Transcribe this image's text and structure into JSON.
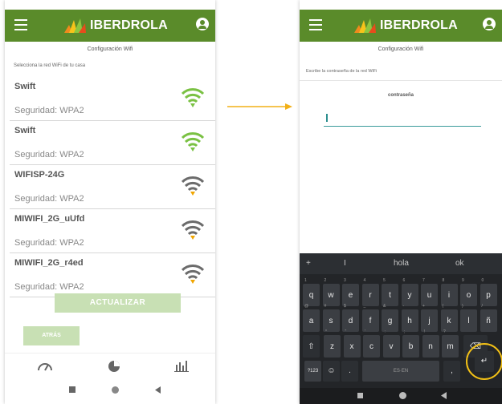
{
  "app": {
    "brand": "IBERDROLA"
  },
  "screen1": {
    "title": "Configuración Wifi",
    "subtitle": "Selecciona la red WiFi de tu casa",
    "networks": [
      {
        "name": "Swift",
        "security": "Seguridad: WPA2",
        "signal_color": "#7ac143"
      },
      {
        "name": "Swift",
        "security": "Seguridad: WPA2",
        "signal_color": "#7ac143"
      },
      {
        "name": "WIFISP-24G",
        "security": "Seguridad: WPA2",
        "signal_color": "#6b6b6b"
      },
      {
        "name": "MIWIFI_2G_uUfd",
        "security": "Seguridad: WPA2",
        "signal_color": "#6b6b6b"
      },
      {
        "name": "MIWIFI_2G_r4ed",
        "security": "Seguridad: WPA2",
        "signal_color": "#6b6b6b"
      }
    ],
    "update_button": "ACTUALIZAR",
    "back_button": "ATRÁS",
    "bottom_nav": [
      "speedometer-icon",
      "pie-chart-icon",
      "bar-chart-icon"
    ]
  },
  "screen2": {
    "title": "Configuración Wifi",
    "subtitle": "Escribe la contraseña de la red WiFi",
    "field_label": "contraseña",
    "password_value": ""
  },
  "keyboard": {
    "suggestions": [
      "+",
      "I",
      "hola",
      "ok"
    ],
    "row1": [
      "q",
      "w",
      "e",
      "r",
      "t",
      "y",
      "u",
      "i",
      "o",
      "p"
    ],
    "row1_alt": [
      "1",
      "2",
      "3",
      "4",
      "5",
      "6",
      "7",
      "8",
      "9",
      "0"
    ],
    "row2": [
      "a",
      "s",
      "d",
      "f",
      "g",
      "h",
      "j",
      "k",
      "l",
      "ñ"
    ],
    "row2_alt": [
      "@",
      "#",
      "$",
      "_",
      "&",
      "-",
      "+",
      "(",
      ")",
      "/"
    ],
    "row3": [
      "z",
      "x",
      "c",
      "v",
      "b",
      "n",
      "m"
    ],
    "row3_alt": [
      "*",
      "\"",
      "'",
      ":",
      ";",
      "!",
      "?"
    ],
    "number_key": "?123",
    "space_label": "ES·EN"
  },
  "colors": {
    "brand_green": "#5a8b2a",
    "button_green": "#c8e0b4",
    "highlight": "#f2c016"
  }
}
